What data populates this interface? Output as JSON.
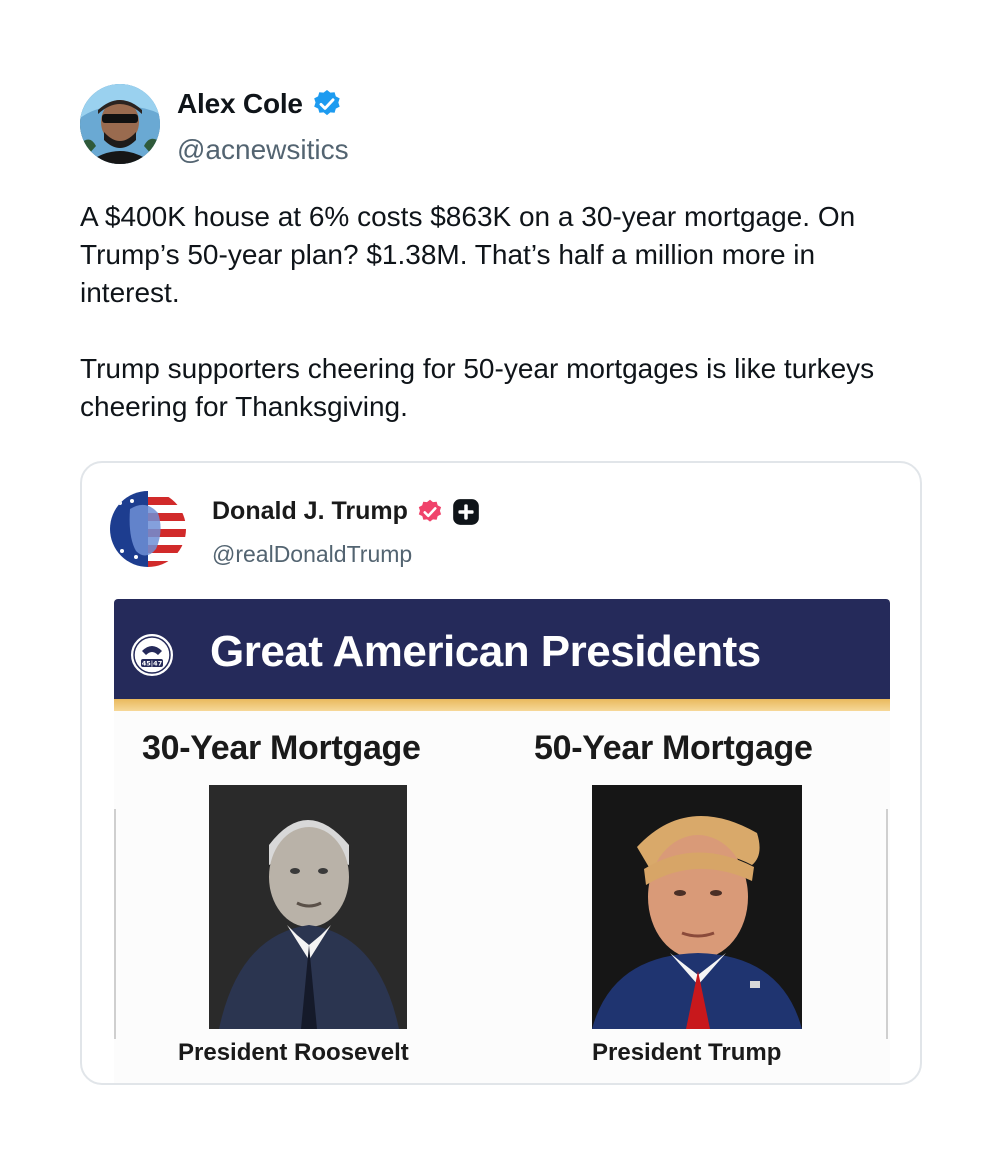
{
  "author": {
    "name": "Alex Cole",
    "handle": "@acnewsitics",
    "verified_color": "#1d9bf0"
  },
  "tweet": {
    "paragraphs": [
      "A $400K house at 6% costs $863K on a 30-year mortgage. On Trump’s 50-year plan? $1.38M. That’s half a million more in interest.",
      "Trump supporters cheering for 50-year mortgages is like turkeys cheering for Thanksgiving."
    ]
  },
  "quoted": {
    "name": "Donald J. Trump",
    "handle": "@realDonaldTrump",
    "badge_color": "#f0436b",
    "poster": {
      "title": "Great American Presidents",
      "seal_text": "45|47",
      "banner_color": "#252a5a",
      "stripe_color": "#efc474",
      "left_heading": "30-Year Mortgage",
      "right_heading": "50-Year Mortgage",
      "left_caption": "President Roosevelt",
      "right_caption": "President Trump"
    }
  }
}
